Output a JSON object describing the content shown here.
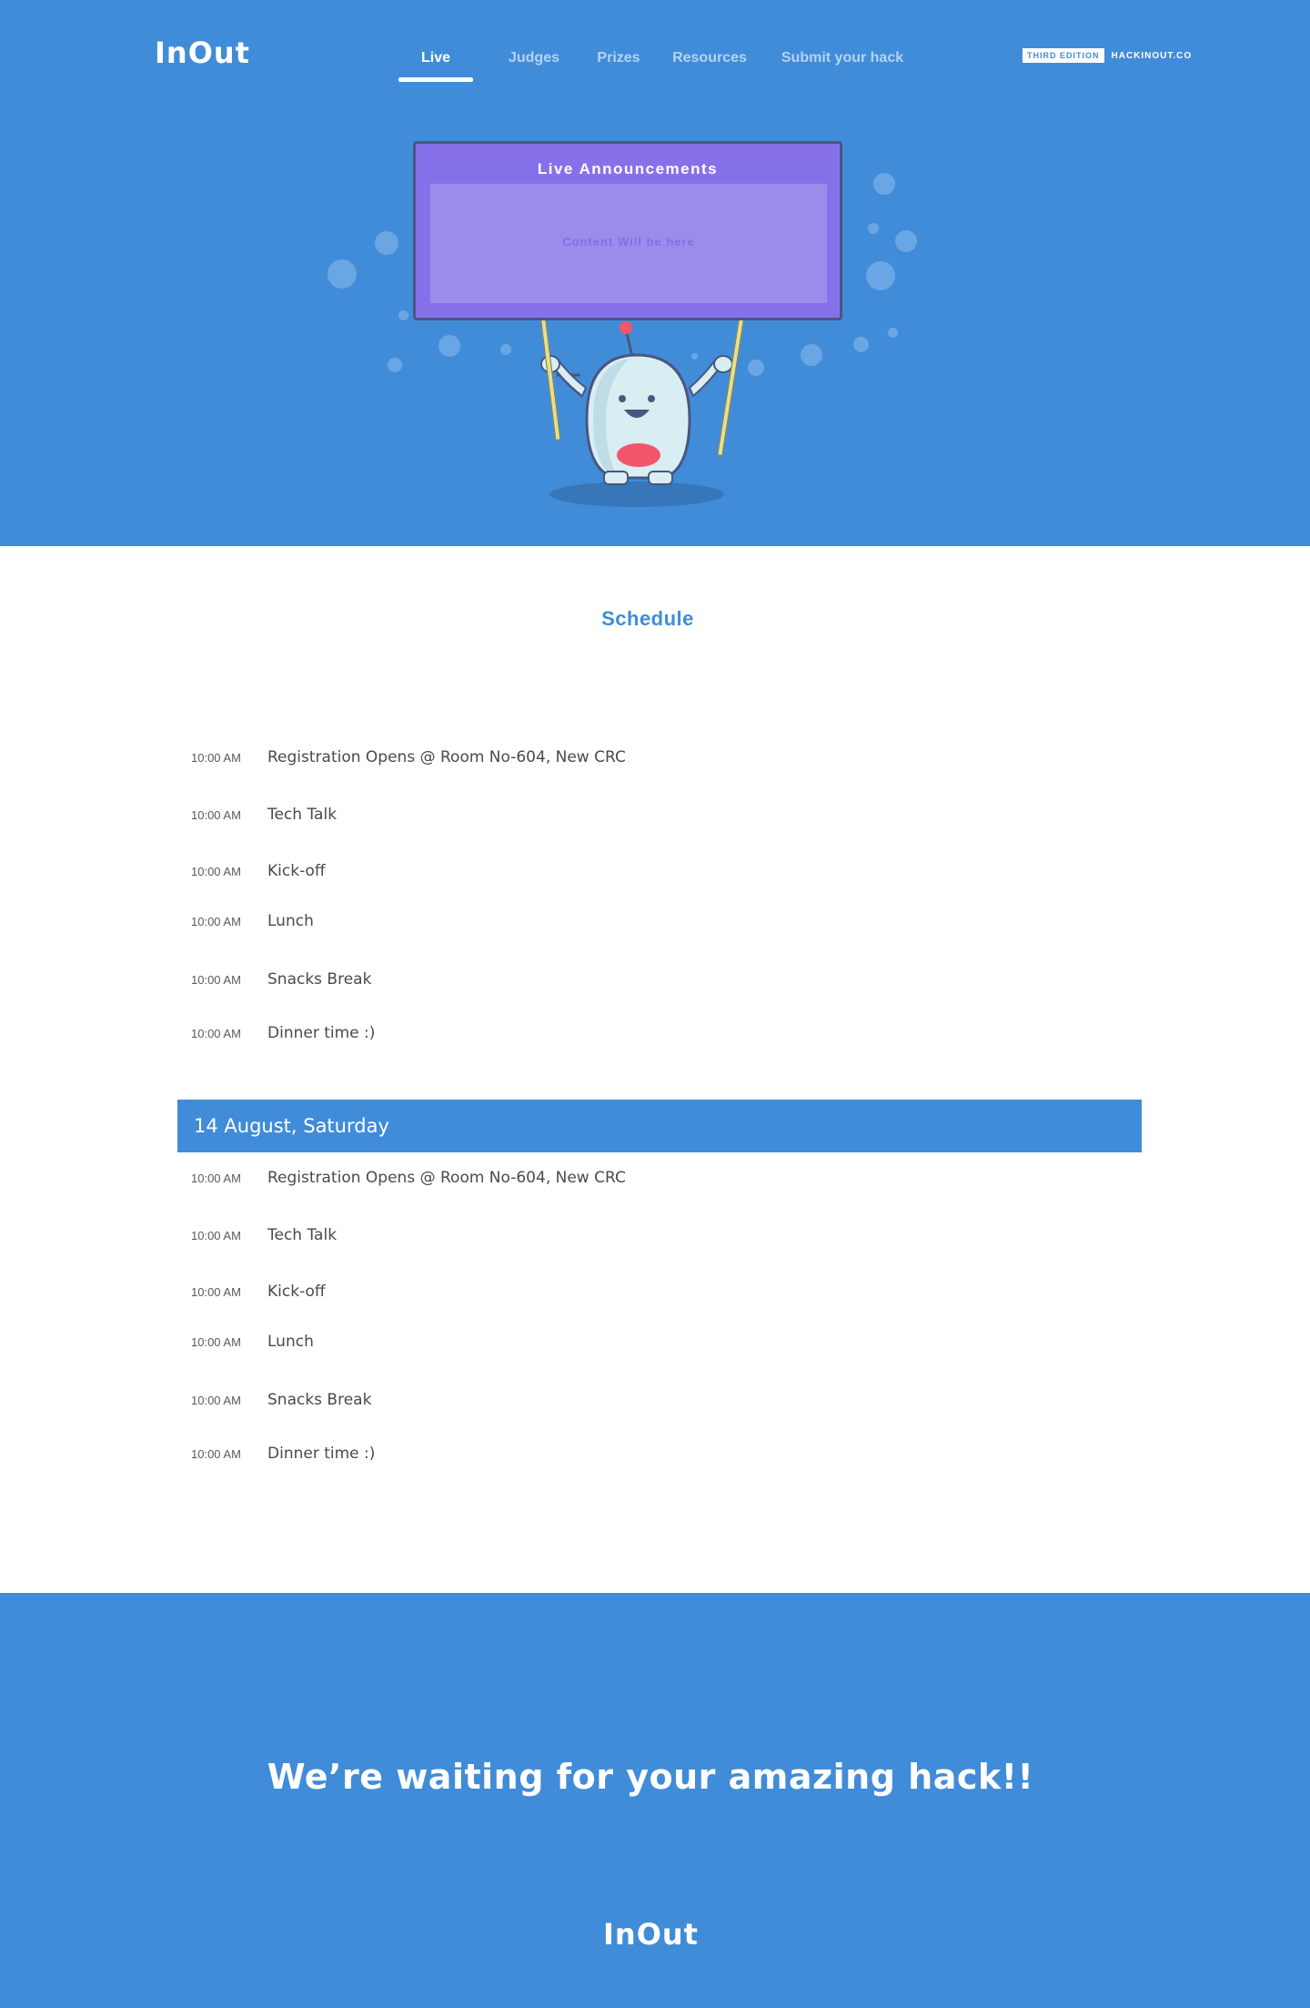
{
  "brand": {
    "logo_text": "InOut",
    "edition_badge": "THIRD EDITION",
    "site": "HACKINOUT.CO"
  },
  "nav": {
    "items": [
      {
        "label": "Live",
        "active": true
      },
      {
        "label": "Judges",
        "active": false
      },
      {
        "label": "Prizes",
        "active": false
      },
      {
        "label": "Resources",
        "active": false
      },
      {
        "label": "Submit your hack",
        "active": false
      }
    ]
  },
  "announcements": {
    "title": "Live Announcements",
    "placeholder": "Content Will be here"
  },
  "schedule": {
    "title": "Schedule",
    "days": [
      {
        "label": "",
        "events": [
          {
            "time": "10:00 AM",
            "title": "Registration Opens @ Room No-604, New CRC"
          },
          {
            "time": "10:00 AM",
            "title": "Tech Talk"
          },
          {
            "time": "10:00 AM",
            "title": "Kick-off"
          },
          {
            "time": "10:00 AM",
            "title": "Lunch"
          },
          {
            "time": "10:00 AM",
            "title": "Snacks Break"
          },
          {
            "time": "10:00 AM",
            "title": "Dinner time :)"
          }
        ]
      },
      {
        "label": "14 August, Saturday",
        "events": [
          {
            "time": "10:00 AM",
            "title": "Registration Opens @ Room No-604, New CRC"
          },
          {
            "time": "10:00 AM",
            "title": "Tech Talk"
          },
          {
            "time": "10:00 AM",
            "title": "Kick-off"
          },
          {
            "time": "10:00 AM",
            "title": "Lunch"
          },
          {
            "time": "10:00 AM",
            "title": "Snacks Break"
          },
          {
            "time": "10:00 AM",
            "title": "Dinner time :)"
          }
        ]
      }
    ]
  },
  "footer": {
    "cta": "We’re waiting for your amazing hack!!"
  },
  "colors": {
    "primary": "#418cd8",
    "board": "#8771ea",
    "text": "#4a4a4a"
  }
}
